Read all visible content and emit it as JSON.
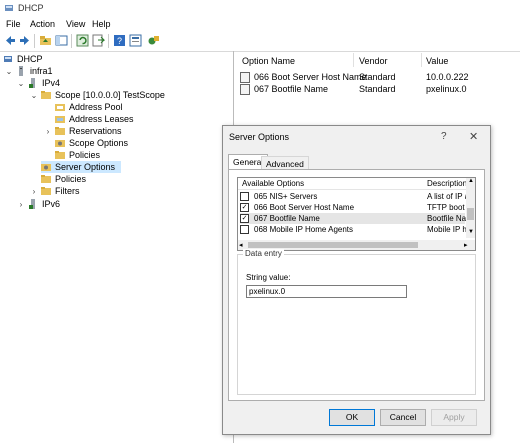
{
  "window": {
    "title": "DHCP"
  },
  "menu": [
    "File",
    "Action",
    "View",
    "Help"
  ],
  "tree": {
    "root": "DHCP",
    "server": "infra1",
    "ipv4": "IPv4",
    "scope": "Scope [10.0.0.0] TestScope",
    "scope_items": [
      "Address Pool",
      "Address Leases",
      "Reservations",
      "Scope Options",
      "Policies"
    ],
    "server_options": "Server Options",
    "policies": "Policies",
    "filters": "Filters",
    "ipv6": "IPv6"
  },
  "list": {
    "columns": [
      "Option Name",
      "Vendor",
      "Value"
    ],
    "rows": [
      {
        "name": "066 Boot Server Host Name",
        "vendor": "Standard",
        "value": "10.0.0.222"
      },
      {
        "name": "067 Bootfile Name",
        "vendor": "Standard",
        "value": "pxelinux.0"
      }
    ]
  },
  "dialog": {
    "title": "Server Options",
    "help": "?",
    "close": "✕",
    "tabs": [
      "General",
      "Advanced"
    ],
    "columns": [
      "Available Options",
      "Description"
    ],
    "options": [
      {
        "label": "065 NIS+ Servers",
        "desc": "A list of IP a",
        "checked": false
      },
      {
        "label": "066 Boot Server Host Name",
        "desc": "TFTP boot s",
        "checked": true
      },
      {
        "label": "067 Bootfile Name",
        "desc": "Bootfile Nan",
        "checked": true
      },
      {
        "label": "068 Mobile IP Home Agents",
        "desc": "Mobile IP ho",
        "checked": false
      }
    ],
    "data_entry_legend": "Data entry",
    "string_label": "String value:",
    "string_value": "pxelinux.0",
    "buttons": {
      "ok": "OK",
      "cancel": "Cancel",
      "apply": "Apply"
    }
  }
}
